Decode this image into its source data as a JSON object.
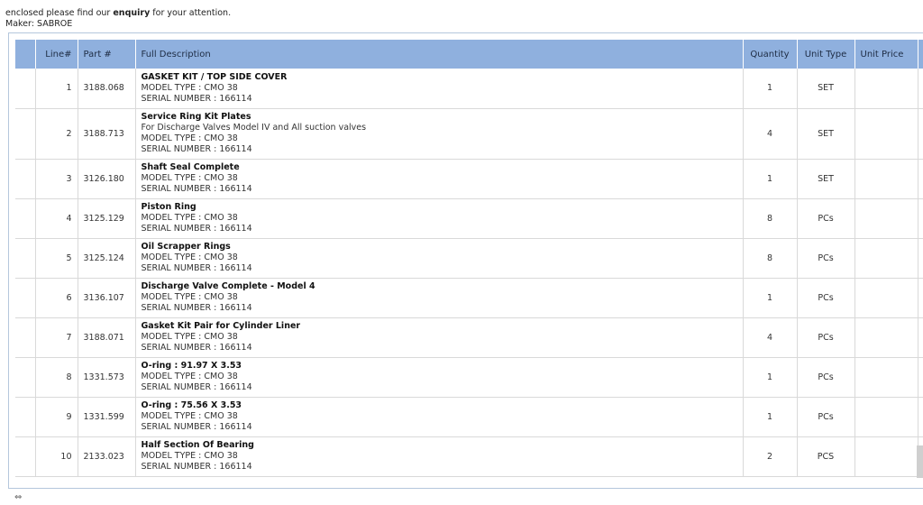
{
  "intro": {
    "pre": "enclosed please find our ",
    "bold": "enquiry",
    "post": " for your attention.",
    "maker": "Maker: SABROE"
  },
  "table": {
    "headers": {
      "line": "Line#",
      "part": "Part #",
      "description": "Full Description",
      "quantity": "Quantity",
      "unit_type": "Unit Type",
      "unit_price": "Unit Price",
      "extra": "("
    },
    "rows": [
      {
        "line": "1",
        "part": "3188.068",
        "title": "GASKET KIT / TOP SIDE COVER",
        "lines": [
          "MODEL TYPE : CMO 38",
          "SERIAL NUMBER : 166114"
        ],
        "qty": "1",
        "unit": "SET",
        "price": ""
      },
      {
        "line": "2",
        "part": "3188.713",
        "title": "Service Ring Kit Plates",
        "lines": [
          "For Discharge Valves Model IV and All suction valves",
          "MODEL TYPE : CMO 38",
          "SERIAL NUMBER : 166114"
        ],
        "qty": "4",
        "unit": "SET",
        "price": ""
      },
      {
        "line": "3",
        "part": "3126.180",
        "title": "Shaft Seal Complete",
        "lines": [
          "MODEL TYPE : CMO 38",
          "SERIAL NUMBER : 166114"
        ],
        "qty": "1",
        "unit": "SET",
        "price": ""
      },
      {
        "line": "4",
        "part": "3125.129",
        "title": "Piston Ring",
        "lines": [
          "MODEL TYPE : CMO 38",
          "SERIAL NUMBER : 166114"
        ],
        "qty": "8",
        "unit": "PCs",
        "price": ""
      },
      {
        "line": "5",
        "part": "3125.124",
        "title": "Oil Scrapper Rings",
        "lines": [
          "MODEL TYPE : CMO 38",
          "SERIAL NUMBER : 166114"
        ],
        "qty": "8",
        "unit": "PCs",
        "price": ""
      },
      {
        "line": "6",
        "part": "3136.107",
        "title": "Discharge Valve Complete - Model 4",
        "lines": [
          "MODEL TYPE : CMO 38",
          "SERIAL NUMBER : 166114"
        ],
        "qty": "1",
        "unit": "PCs",
        "price": ""
      },
      {
        "line": "7",
        "part": "3188.071",
        "title": "Gasket Kit Pair for Cylinder Liner",
        "lines": [
          "MODEL TYPE : CMO 38",
          "SERIAL NUMBER : 166114"
        ],
        "qty": "4",
        "unit": "PCs",
        "price": ""
      },
      {
        "line": "8",
        "part": "1331.573",
        "title": "O-ring : 91.97 X 3.53",
        "lines": [
          "MODEL TYPE : CMO 38",
          "SERIAL NUMBER : 166114"
        ],
        "qty": "1",
        "unit": "PCs",
        "price": ""
      },
      {
        "line": "9",
        "part": "1331.599",
        "title": "O-ring : 75.56 X 3.53",
        "lines": [
          "MODEL TYPE : CMO 38",
          "SERIAL NUMBER : 166114"
        ],
        "qty": "1",
        "unit": "PCs",
        "price": ""
      },
      {
        "line": "10",
        "part": "2133.023",
        "title": "Half Section Of Bearing",
        "lines": [
          "MODEL TYPE : CMO 38",
          "SERIAL NUMBER : 166114"
        ],
        "qty": "2",
        "unit": "PCS",
        "price": ""
      }
    ]
  },
  "footer": {
    "icon": "link-icon",
    "glyph": "⇔"
  }
}
